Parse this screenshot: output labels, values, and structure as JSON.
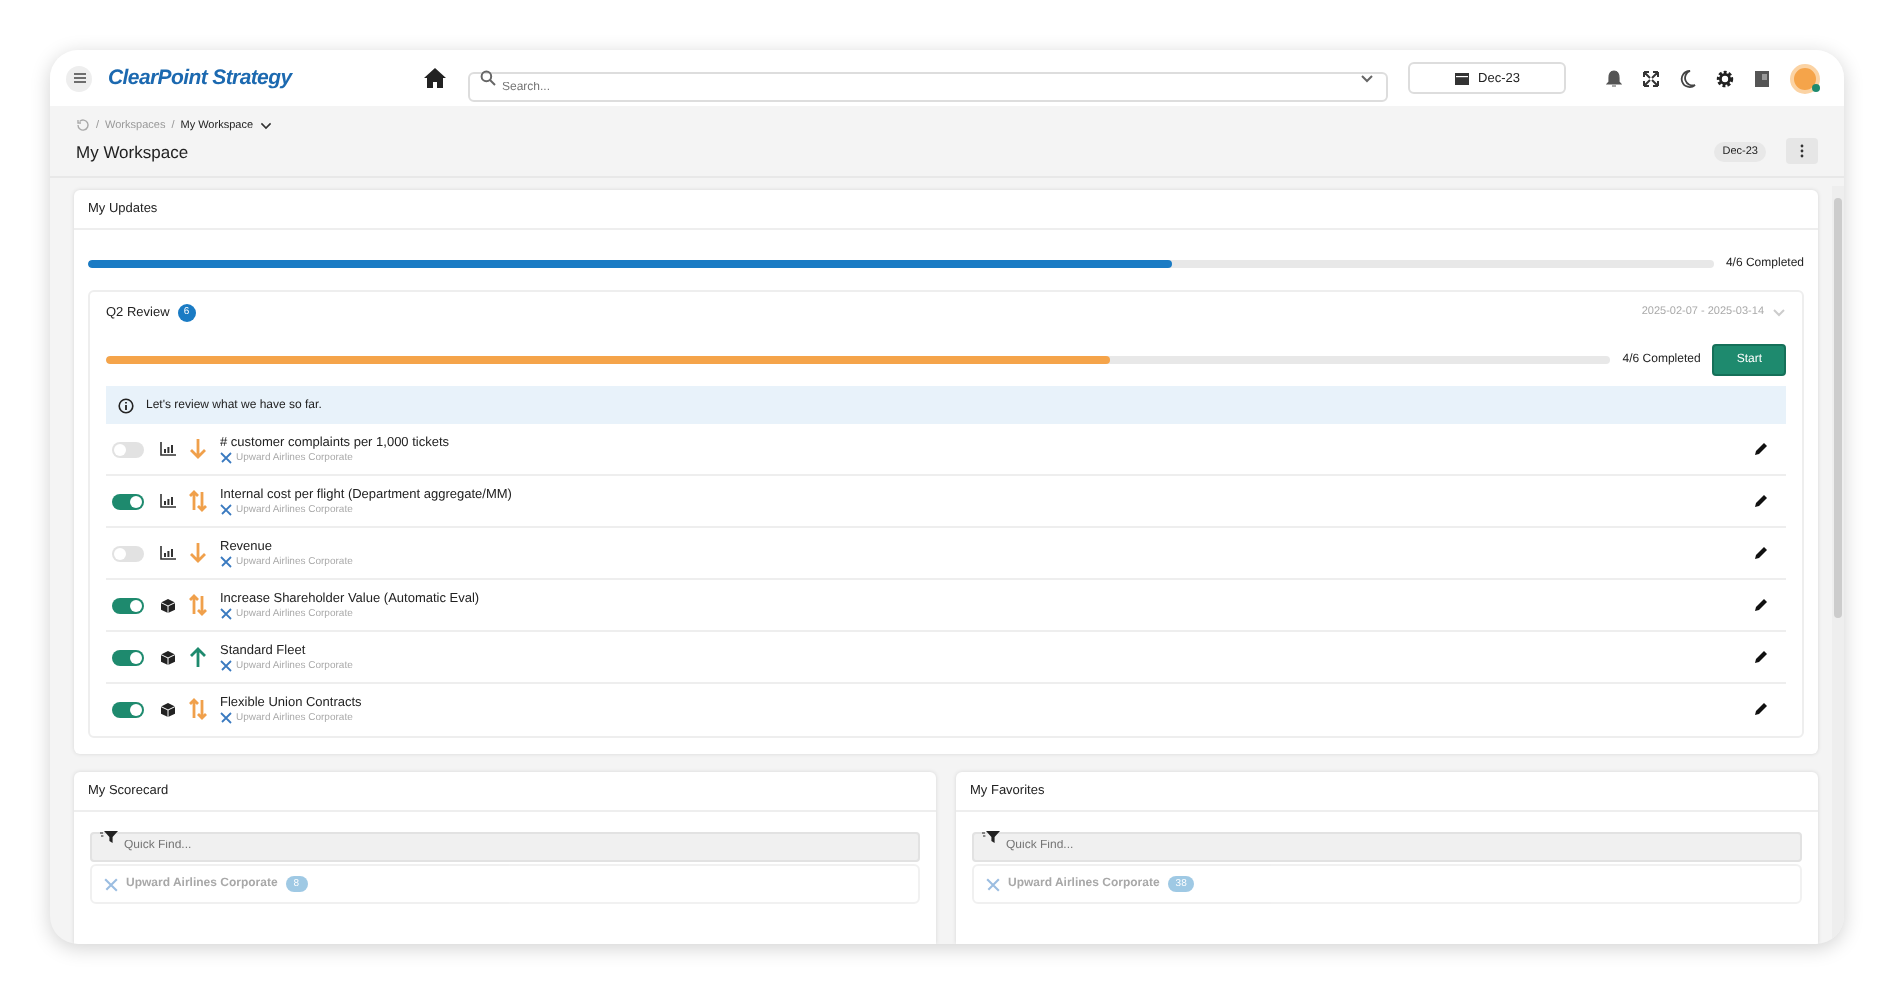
{
  "header": {
    "logo": "ClearPoint Strategy",
    "search": {
      "placeholder": "Search..."
    },
    "period": "Dec-23"
  },
  "breadcrumb": {
    "items": [
      {
        "separator": "/",
        "label": "Workspaces"
      },
      {
        "separator": "/",
        "label": "My Workspace"
      }
    ],
    "title": "My Workspace",
    "period": "Dec-23"
  },
  "updates": {
    "title": "My Updates",
    "level": 0.667,
    "progress_label": "4/6 Completed",
    "review": {
      "title": "Q2 Review",
      "badge": "6",
      "dates": "2025-02-07 - 2025-03-14",
      "level": 0.667,
      "progress_label": "4/6 Completed",
      "button": "Start",
      "notice": "Let's review what we have so far.",
      "rows": [
        {
          "on": false,
          "kind": "measure",
          "trend": {
            "kind": "down"
          },
          "name": "# customer complaints per 1,000 tickets",
          "owner": "Upward Airlines Corporate"
        },
        {
          "on": true,
          "kind": "measure",
          "trend": {
            "kind": "both"
          },
          "name": "Internal cost per flight (Department aggregate/MM)",
          "owner": "Upward Airlines Corporate"
        },
        {
          "on": false,
          "kind": "measure",
          "trend": {
            "kind": "down"
          },
          "name": "Revenue",
          "owner": "Upward Airlines Corporate"
        },
        {
          "on": true,
          "kind": "objective",
          "trend": {
            "kind": "both"
          },
          "name": "Increase Shareholder Value (Automatic Eval)",
          "owner": "Upward Airlines Corporate"
        },
        {
          "on": true,
          "kind": "objective",
          "trend": {
            "kind": "up"
          },
          "name": "Standard Fleet",
          "owner": "Upward Airlines Corporate"
        },
        {
          "on": true,
          "kind": "objective",
          "trend": {
            "kind": "both"
          },
          "name": "Flexible Union Contracts",
          "owner": "Upward Airlines Corporate"
        }
      ]
    }
  },
  "panels": [
    {
      "title": "My Scorecard",
      "placeholder": "Quick Find...",
      "group": "Upward Airlines Corporate",
      "badge": "8"
    },
    {
      "title": "My Favorites",
      "placeholder": "Quick Find...",
      "group": "Upward Airlines Corporate",
      "badge": "38"
    }
  ]
}
